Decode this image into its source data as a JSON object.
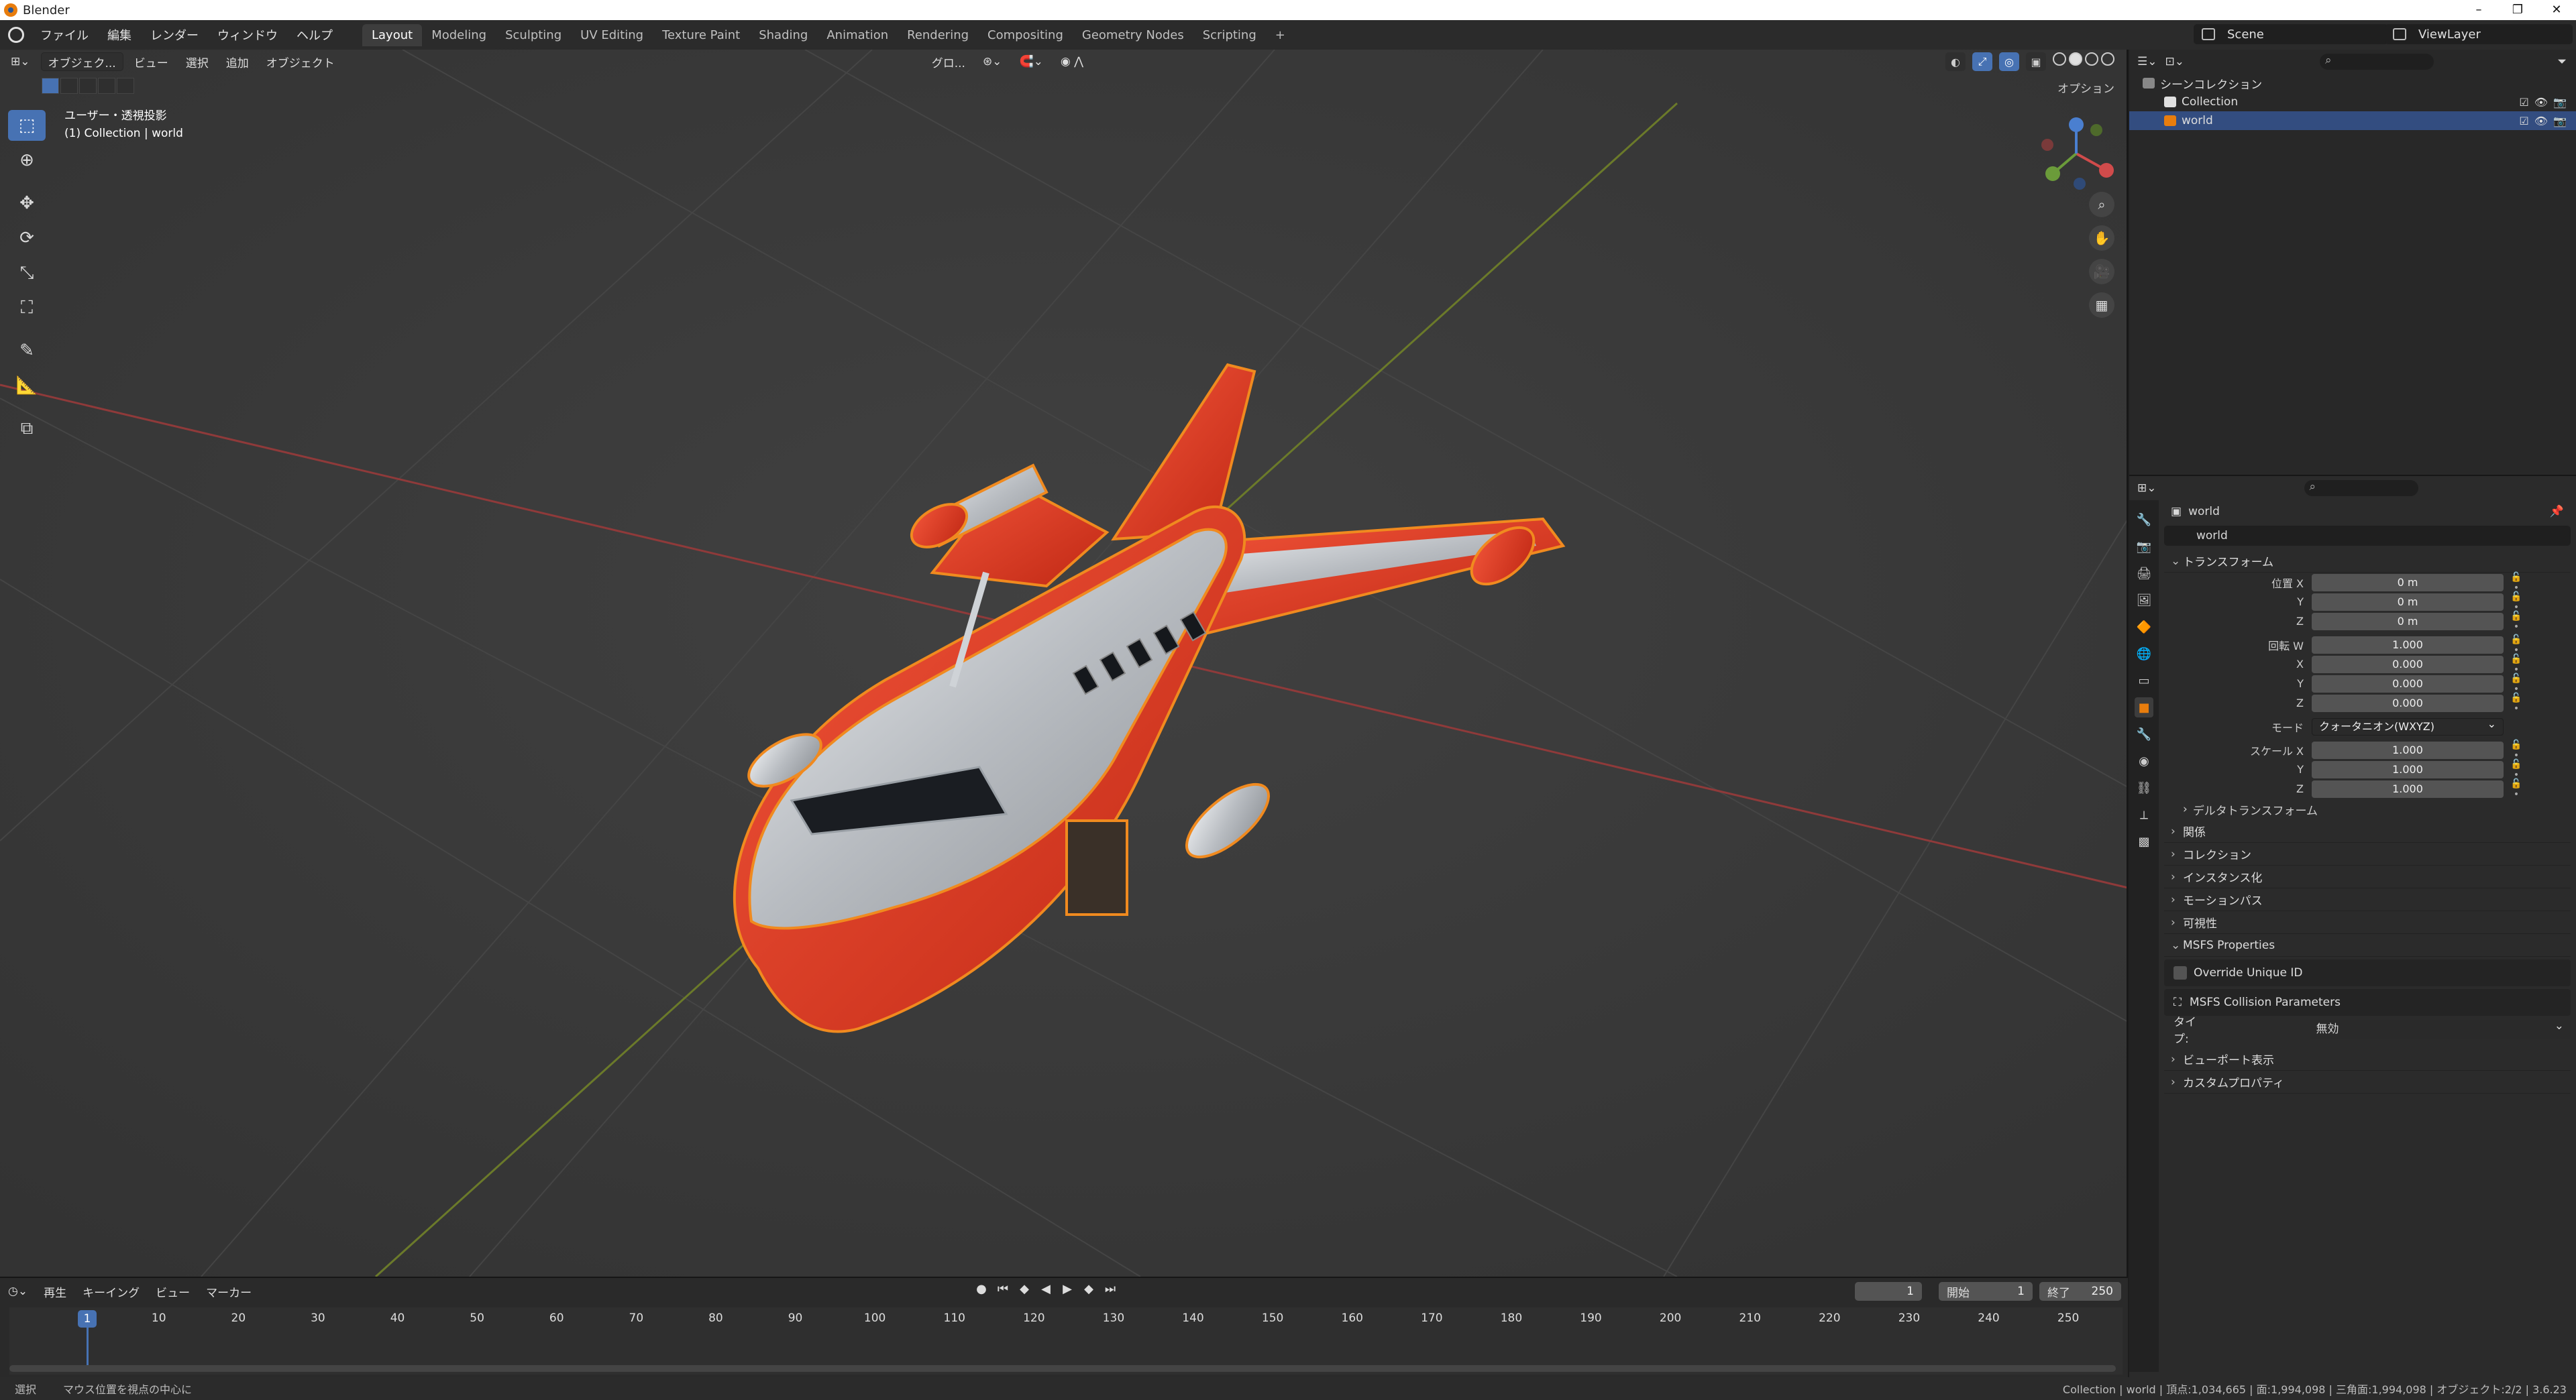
{
  "window": {
    "title": "Blender"
  },
  "menu": [
    "ファイル",
    "編集",
    "レンダー",
    "ウィンドウ",
    "ヘルプ"
  ],
  "workspaces": [
    "Layout",
    "Modeling",
    "Sculpting",
    "UV Editing",
    "Texture Paint",
    "Shading",
    "Animation",
    "Rendering",
    "Compositing",
    "Geometry Nodes",
    "Scripting"
  ],
  "active_workspace": "Layout",
  "scene": "Scene",
  "view_layer": "ViewLayer",
  "viewport": {
    "mode": "オブジェク...",
    "menus": [
      "ビュー",
      "選択",
      "追加",
      "オブジェクト"
    ],
    "transform_orientation": "グロ...",
    "options": "オプション",
    "view_name": "ユーザー・透視投影",
    "collection_info": "(1) Collection | world"
  },
  "outliner": {
    "items": [
      {
        "label": "シーンコレクション",
        "indent": 0
      },
      {
        "label": "Collection",
        "indent": 1
      },
      {
        "label": "world",
        "indent": 1,
        "selected": true
      }
    ]
  },
  "properties": {
    "object_name": "world",
    "name_field": "world",
    "transform_label": "トランスフォーム",
    "location": {
      "label": "位置 X",
      "x": "0 m",
      "y": "0 m",
      "z": "0 m"
    },
    "rotation": {
      "label": "回転 W",
      "w": "1.000",
      "x": "0.000",
      "y": "0.000",
      "z": "0.000"
    },
    "mode_label": "モード",
    "mode_value": "クォータニオン(WXYZ)",
    "scale": {
      "label": "スケール X",
      "x": "1.000",
      "y": "1.000",
      "z": "1.000"
    },
    "axis": {
      "x": "X",
      "y": "Y",
      "z": "Z"
    },
    "delta_transform": "デルタトランスフォーム",
    "panels": [
      "関係",
      "コレクション",
      "インスタンス化",
      "モーションパス",
      "可視性"
    ],
    "msfs": {
      "header": "MSFS Properties",
      "override_uid": "Override Unique ID",
      "collision": "MSFS Collision Parameters",
      "type_label": "タイプ:",
      "type_value": "無効"
    },
    "panels_bottom": [
      "ビューポート表示",
      "カスタムプロパティ"
    ]
  },
  "timeline": {
    "menus": [
      "再生",
      "キーイング",
      "ビュー",
      "マーカー"
    ],
    "current_frame": "1",
    "start_label": "開始",
    "start": "1",
    "end_label": "終了",
    "end": "250",
    "ticks": [
      "1",
      "10",
      "20",
      "30",
      "40",
      "50",
      "60",
      "70",
      "80",
      "90",
      "100",
      "110",
      "120",
      "130",
      "140",
      "150",
      "160",
      "170",
      "180",
      "190",
      "200",
      "210",
      "220",
      "230",
      "240",
      "250"
    ]
  },
  "statusbar": {
    "left": [
      "選択",
      "マウス位置を視点の中心に"
    ],
    "right": "Collection | world | 頂点:1,034,665 | 面:1,994,098 | 三角面:1,994,098 | オブジェクト:2/2 | 3.6.23"
  },
  "colors": {
    "accent": "#4772b3",
    "selection_orange": "#e87d0d",
    "aircraft_red": "#d9361e",
    "aircraft_silver": "#c9ccd0"
  }
}
